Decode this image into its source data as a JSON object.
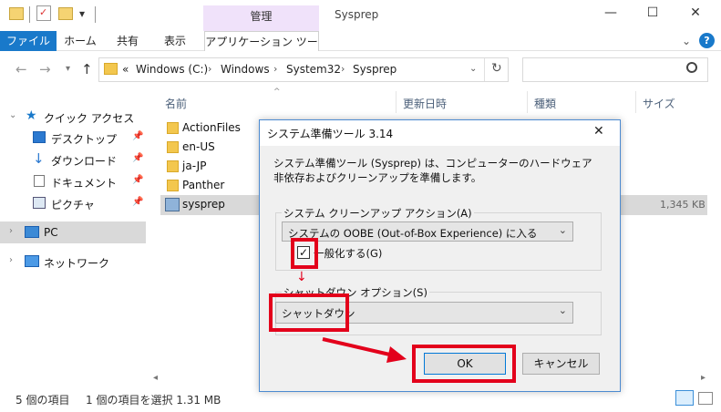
{
  "window": {
    "title": "Sysprep",
    "context_tab_group": "管理",
    "minimize": "—",
    "maximize": "☐",
    "close": "✕"
  },
  "ribbon": {
    "tabs": [
      "ファイル",
      "ホーム",
      "共有",
      "表示",
      "アプリケーション ツール"
    ],
    "help": "?",
    "expand": "⌄"
  },
  "address": {
    "prefix": "«",
    "crumbs": [
      "Windows (C:)",
      "Windows",
      "System32",
      "Sysprep"
    ],
    "search_placeholder": ""
  },
  "nav_pane": {
    "quick_access": "クイック アクセス",
    "pinned": [
      "デスクトップ",
      "ダウンロード",
      "ドキュメント",
      "ピクチャ"
    ],
    "pc": "PC",
    "network": "ネットワーク"
  },
  "columns": [
    "名前",
    "更新日時",
    "種類",
    "サイズ"
  ],
  "files": [
    {
      "name": "ActionFiles",
      "type": "folder",
      "size": ""
    },
    {
      "name": "en-US",
      "type": "folder",
      "size": ""
    },
    {
      "name": "ja-JP",
      "type": "folder",
      "size": ""
    },
    {
      "name": "Panther",
      "type": "folder",
      "size": ""
    },
    {
      "name": "sysprep",
      "type": "app",
      "size": "1,345 KB"
    }
  ],
  "status": {
    "item_count": "5 個の項目",
    "selection": "1 個の項目を選択 1.31 MB"
  },
  "dialog": {
    "title": "システム準備ツール 3.14",
    "close": "✕",
    "description": "システム準備ツール (Sysprep) は、コンピューターのハードウェア非依存およびクリーンアップを準備します。",
    "cleanup_group": "システム クリーンアップ アクション(A)",
    "cleanup_value": "システムの OOBE (Out-of-Box Experience) に入る",
    "generalize_label": "一般化する(G)",
    "generalize_checked": true,
    "shutdown_group": "シャットダウン オプション(S)",
    "shutdown_value": "シャットダウン",
    "ok": "OK",
    "cancel": "キャンセル"
  },
  "colors": {
    "accent": "#1979ca",
    "context_tab": "#f0e2fa",
    "highlight": "#e3001b",
    "selected_row": "#cce8ff"
  }
}
